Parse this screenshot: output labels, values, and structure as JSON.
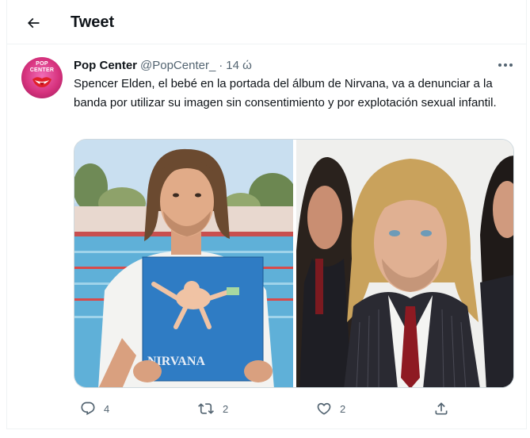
{
  "header": {
    "title": "Tweet",
    "back_icon": "arrow-left-icon"
  },
  "tweet": {
    "author": {
      "name": "Pop Center",
      "handle": "@PopCenter_",
      "avatar_text": "POP CENTER",
      "avatar_color": "#d7337e"
    },
    "separator": "·",
    "time": "14 ώ",
    "more_icon": "more-horizontal-icon",
    "text": "Spencer Elden, el bebé en la portada del álbum de Nirvana, va a denunciar a la banda por utilizar su imagen sin consentimiento y por explotación sexual infantil.",
    "media": {
      "left_album_lettering": "NIRVANA"
    },
    "actions": {
      "replies": {
        "icon": "reply-icon",
        "count": "4"
      },
      "retweets": {
        "icon": "retweet-icon",
        "count": "2"
      },
      "likes": {
        "icon": "heart-icon",
        "count": "2"
      },
      "share": {
        "icon": "share-icon"
      }
    }
  },
  "colors": {
    "text_primary": "#0f1419",
    "text_secondary": "#536471",
    "border": "#eff3f4",
    "pool_blue": "#5fb0d8"
  }
}
